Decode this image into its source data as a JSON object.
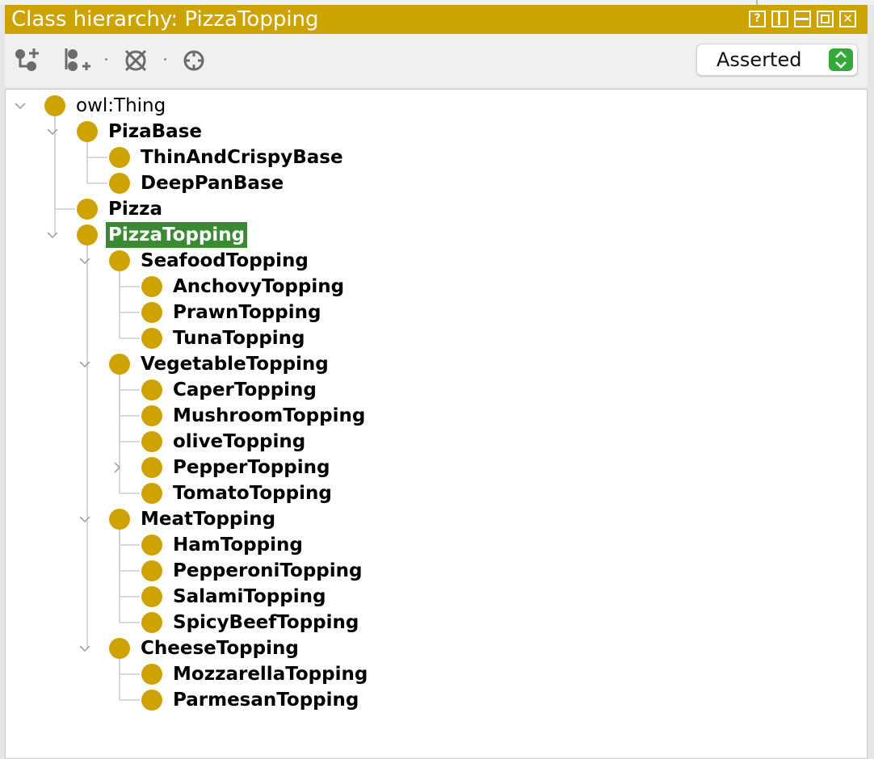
{
  "window": {
    "title": "Class hierarchy: PizzaTopping",
    "buttons": {
      "help": "?",
      "close": "✕"
    }
  },
  "toolbar": {
    "tools": [
      "add-subclass-icon",
      "add-sibling-class-icon",
      "delete-class-icon",
      "find-icon"
    ],
    "view_mode": "Asserted"
  },
  "colors": {
    "title_bar": "#cca300",
    "class_icon": "#cca300",
    "selection": "#3a8a34",
    "select_arrows": "#34a93a"
  },
  "hierarchy": {
    "root": "owl:Thing",
    "selected": "PizzaTopping",
    "nodes": [
      "owl:Thing",
      "PizaBase",
      "ThinAndCrispyBase",
      "DeepPanBase",
      "Pizza",
      "PizzaTopping",
      "SeafoodTopping",
      "AnchovyTopping",
      "PrawnTopping",
      "TunaTopping",
      "VegetableTopping",
      "CaperTopping",
      "MushroomTopping",
      "oliveTopping",
      "PepperTopping",
      "TomatoTopping",
      "MeatTopping",
      "HamTopping",
      "PepperoniTopping",
      "SalamiTopping",
      "SpicyBeefTopping",
      "CheeseTopping",
      "MozzarellaTopping",
      "ParmesanTopping"
    ]
  }
}
